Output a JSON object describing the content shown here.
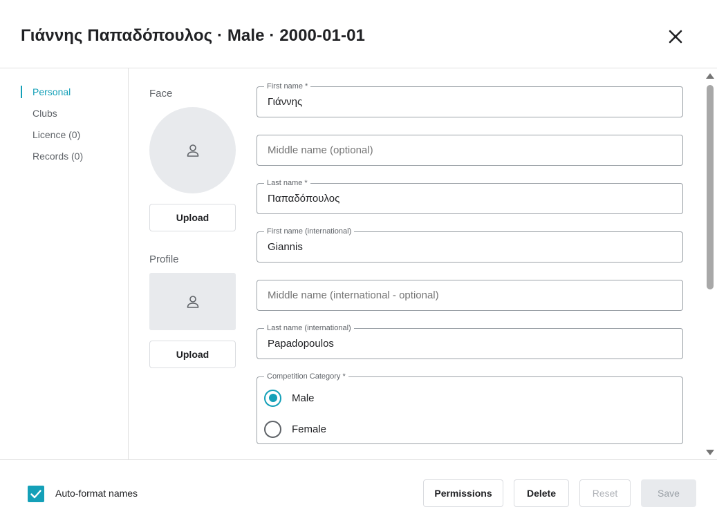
{
  "header": {
    "title": "Γιάννης Παπαδόπουλος · Male · 2000-01-01"
  },
  "sidebar": {
    "items": [
      {
        "label": "Personal",
        "active": true
      },
      {
        "label": "Clubs",
        "active": false
      },
      {
        "label": "Licence (0)",
        "active": false
      },
      {
        "label": "Records (0)",
        "active": false
      }
    ]
  },
  "photos": {
    "face_label": "Face",
    "profile_label": "Profile",
    "upload_label": "Upload"
  },
  "form": {
    "first_name": {
      "label": "First name  *",
      "value": "Γιάννης"
    },
    "middle_name": {
      "placeholder": "Middle name (optional)"
    },
    "last_name": {
      "label": "Last name  *",
      "value": "Παπαδόπουλος"
    },
    "first_name_intl": {
      "label": "First name (international)",
      "value": "Giannis"
    },
    "middle_name_intl": {
      "placeholder": "Middle name (international - optional)"
    },
    "last_name_intl": {
      "label": "Last name (international)",
      "value": "Papadopoulos"
    },
    "competition_category": {
      "label": "Competition Category  *",
      "options": [
        "Male",
        "Female"
      ],
      "selected": "Male"
    }
  },
  "footer": {
    "auto_format_label": "Auto-format names",
    "auto_format_checked": true,
    "permissions_label": "Permissions",
    "delete_label": "Delete",
    "reset_label": "Reset",
    "save_label": "Save"
  },
  "colors": {
    "accent": "#14a0b8",
    "placeholder_bg": "#e8eaed"
  },
  "icons": {
    "close": "close-icon",
    "person": "person-icon",
    "check": "check-icon",
    "scroll_up": "arrow-up-icon",
    "scroll_down": "arrow-down-icon"
  }
}
